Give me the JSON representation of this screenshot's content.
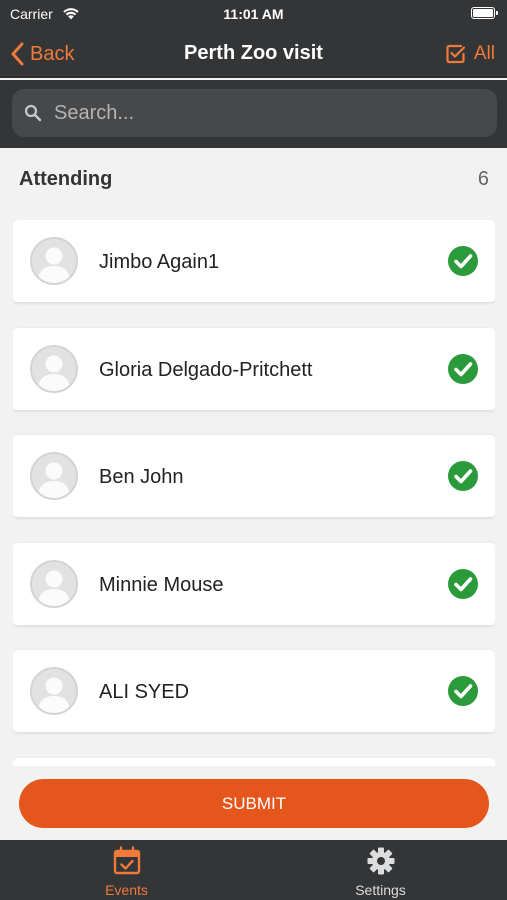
{
  "status_bar": {
    "carrier": "Carrier",
    "time": "11:01 AM"
  },
  "nav": {
    "back_label": "Back",
    "title": "Perth Zoo visit",
    "all_label": "All"
  },
  "search": {
    "placeholder": "Search..."
  },
  "section": {
    "title": "Attending",
    "count": "6"
  },
  "attendees": [
    {
      "name": "Jimbo Again1",
      "attending": true
    },
    {
      "name": "Gloria Delgado-Pritchett",
      "attending": true
    },
    {
      "name": "Ben John",
      "attending": true
    },
    {
      "name": "Minnie Mouse",
      "attending": true
    },
    {
      "name": "ALI SYED",
      "attending": true
    }
  ],
  "submit": {
    "label": "SUBMIT"
  },
  "tabs": [
    {
      "label": "Events",
      "icon": "calendar-check-icon",
      "active": true
    },
    {
      "label": "Settings",
      "icon": "gear-icon",
      "active": false
    }
  ],
  "colors": {
    "accent": "#f07a3a",
    "submit": "#e5561d",
    "check": "#2a9a3a",
    "bar_bg": "#333537",
    "inactive_tab": "#dddddd"
  }
}
